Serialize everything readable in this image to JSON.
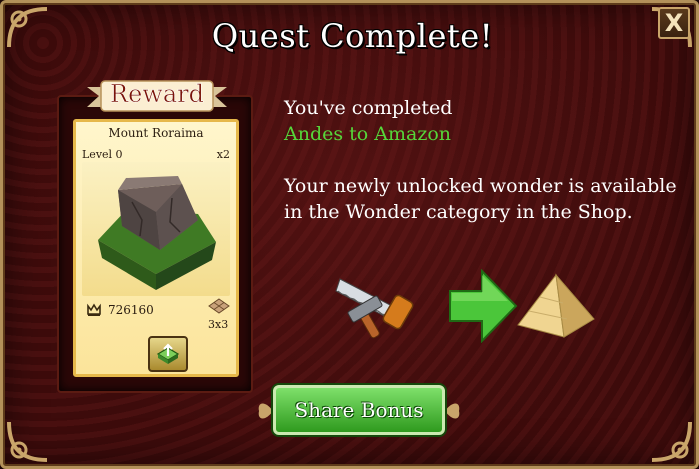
{
  "dialog": {
    "title": "Quest Complete!",
    "close_label": "X"
  },
  "reward": {
    "ribbon_label": "Reward",
    "card": {
      "name": "Mount Roraima",
      "level": "Level 0",
      "quantity": "x2",
      "cost": "726160",
      "size": "3x3"
    }
  },
  "message": {
    "completed_line": "You've completed",
    "quest_name": "Andes to Amazon",
    "body": "Your newly unlocked wonder is available in the Wonder category in the Shop."
  },
  "actions": {
    "share_label": "Share Bonus"
  },
  "colors": {
    "background": "#420c0c",
    "quest_name": "#56d63a",
    "share_button": "#3fae2a",
    "gold_trim": "#c9a56a"
  },
  "icons": {
    "close": "close-icon",
    "tools": "hammer-saw-icon",
    "arrow": "green-arrow-right-icon",
    "wonder": "pyramid-icon",
    "cost": "crown-icon",
    "size": "grid-tiles-icon",
    "place": "place-in-world-icon"
  }
}
